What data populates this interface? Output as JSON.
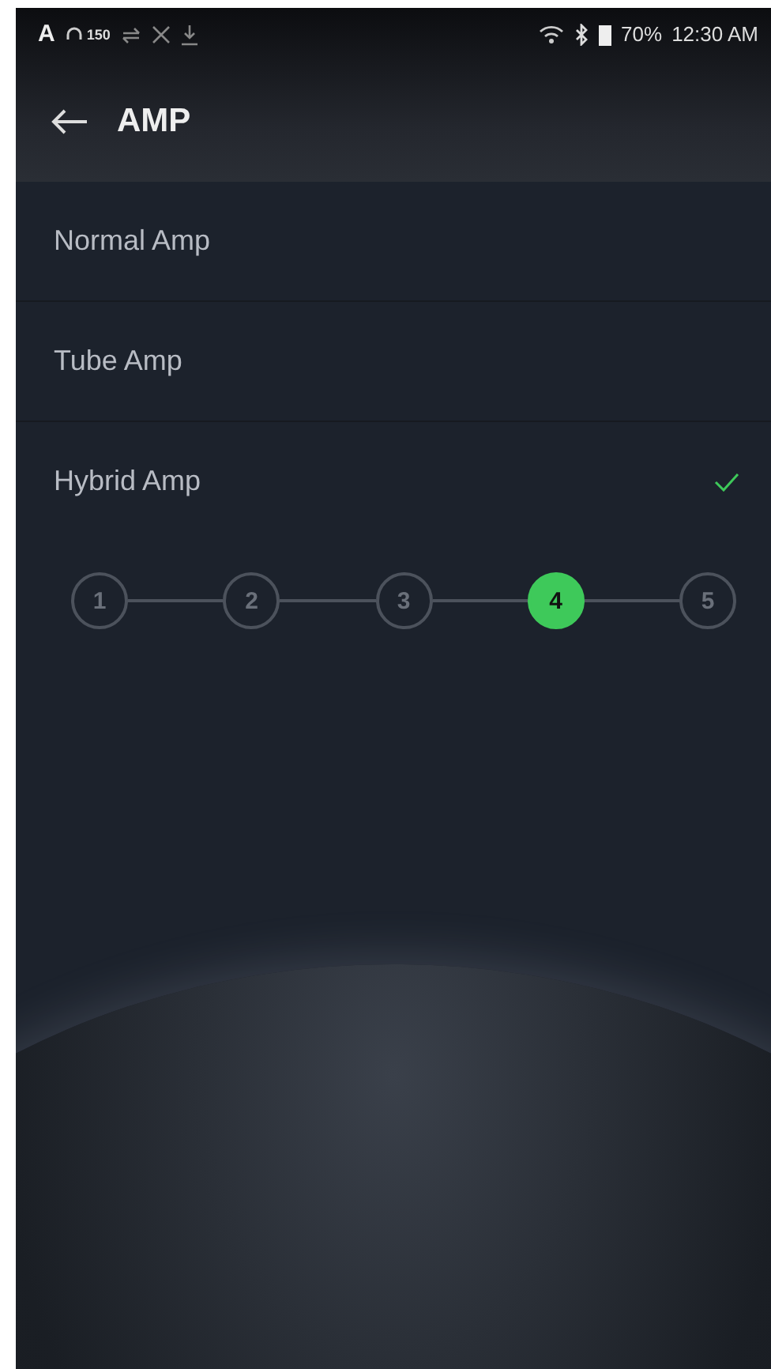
{
  "status_bar": {
    "left_letter": "A",
    "volume": "150",
    "battery": "70%",
    "time": "12:30 AM"
  },
  "header": {
    "title": "AMP"
  },
  "options": [
    {
      "label": "Normal Amp",
      "selected": false
    },
    {
      "label": "Tube Amp",
      "selected": false
    },
    {
      "label": "Hybrid Amp",
      "selected": true
    }
  ],
  "steps": [
    {
      "label": "1",
      "selected": false
    },
    {
      "label": "2",
      "selected": false
    },
    {
      "label": "3",
      "selected": false
    },
    {
      "label": "4",
      "selected": true
    },
    {
      "label": "5",
      "selected": false
    }
  ]
}
